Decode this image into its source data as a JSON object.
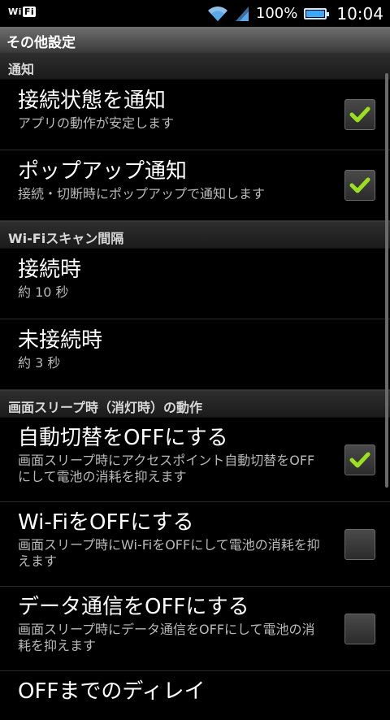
{
  "status_bar": {
    "wifi_label": "Wi",
    "wifi_label_boxed": "Fi",
    "battery_percent": "100%",
    "time": "10:04"
  },
  "titlebar": {
    "title": "その他設定"
  },
  "sections": [
    {
      "header": "通知",
      "items": [
        {
          "title": "接続状態を通知",
          "summary": "アプリの動作が安定します",
          "checked": true
        },
        {
          "title": "ポップアップ通知",
          "summary": "接続・切断時にポップアップで通知します",
          "checked": true
        }
      ]
    },
    {
      "header": "Wi-Fiスキャン間隔",
      "items": [
        {
          "title": "接続時",
          "summary": "約 10 秒"
        },
        {
          "title": "未接続時",
          "summary": "約 3 秒"
        }
      ]
    },
    {
      "header": "画面スリープ時（消灯時）の動作",
      "items": [
        {
          "title": "自動切替をOFFにする",
          "summary": "画面スリープ時にアクセスポイント自動切替をOFFにして電池の消耗を抑えます",
          "checked": true
        },
        {
          "title": "Wi-FiをOFFにする",
          "summary": "画面スリープ時にWi-FiをOFFにして電池の消耗を抑えます",
          "checked": false
        },
        {
          "title": "データ通信をOFFにする",
          "summary": "画面スリープ時にデータ通信をOFFにして電池の消耗を抑えます",
          "checked": false
        },
        {
          "title": "OFFまでのディレイ",
          "summary": ""
        }
      ]
    }
  ],
  "colors": {
    "check_green": "#9be01e",
    "title_bar": "#555555"
  }
}
